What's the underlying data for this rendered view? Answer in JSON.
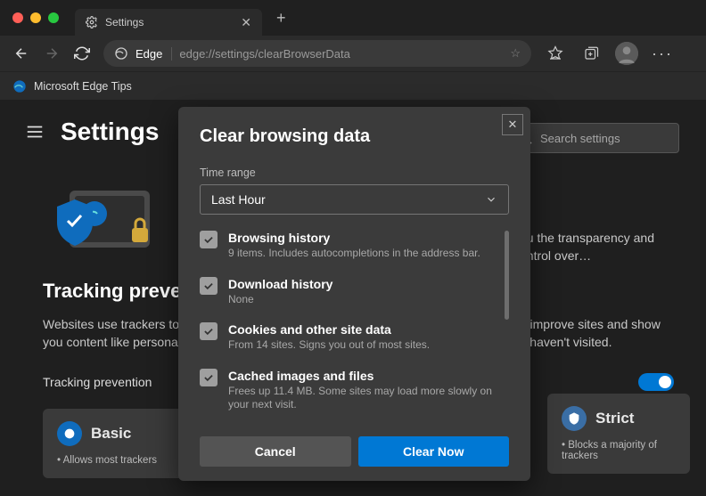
{
  "window": {
    "tab_title": "Settings",
    "browser_label": "Edge",
    "url": "edge://settings/clearBrowserData",
    "bookmark": "Microsoft Edge Tips"
  },
  "page": {
    "title": "Settings",
    "search_placeholder": "Search settings",
    "section_heading": "Tracking prevention",
    "section_text_l1": "Websites use trackers to collect info about your browsing. Websites may use this info to improve sites and show",
    "section_text_l2": "you content like personalized ads. Some trackers collect and send your info to sites you haven't visited.",
    "peek_text": "you the transparency and control over…",
    "prev_toggle_label": "Tracking prevention",
    "plans": {
      "basic": {
        "name": "Basic",
        "bullet": "Allows most trackers"
      },
      "strict": {
        "name": "Strict",
        "bullet": "Blocks a majority of trackers"
      }
    }
  },
  "dialog": {
    "title": "Clear browsing data",
    "time_label": "Time range",
    "time_value": "Last Hour",
    "items": [
      {
        "title": "Browsing history",
        "desc": "9 items. Includes autocompletions in the address bar."
      },
      {
        "title": "Download history",
        "desc": "None"
      },
      {
        "title": "Cookies and other site data",
        "desc": "From 14 sites. Signs you out of most sites."
      },
      {
        "title": "Cached images and files",
        "desc": "Frees up 11.4 MB. Some sites may load more slowly on your next visit."
      }
    ],
    "cancel": "Cancel",
    "confirm": "Clear Now"
  }
}
